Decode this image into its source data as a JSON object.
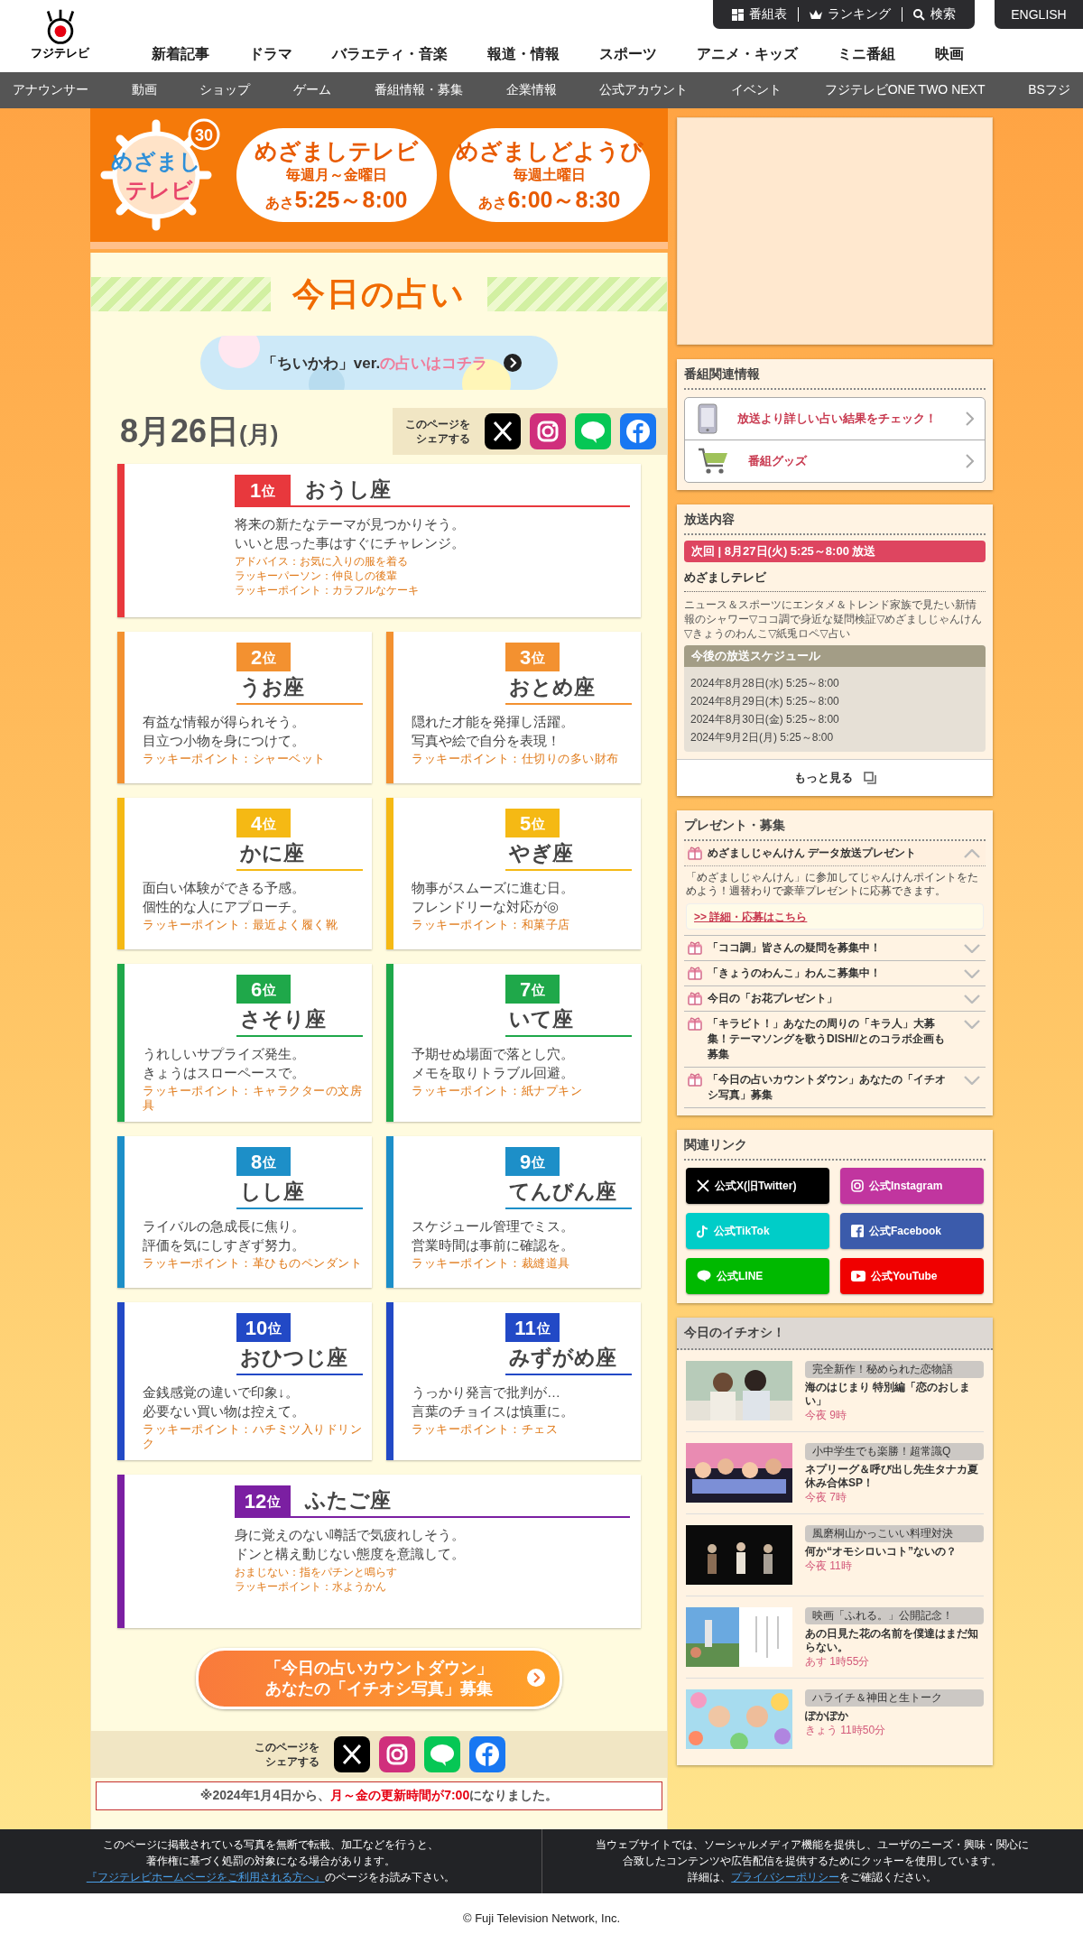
{
  "header": {
    "logo_text": "フジテレビ",
    "top_links": [
      {
        "label": "番組表",
        "kind": "grid"
      },
      {
        "label": "ランキング",
        "kind": "crown"
      },
      {
        "label": "検索",
        "kind": "search"
      }
    ],
    "english": "ENGLISH",
    "main_nav": [
      "新着記事",
      "ドラマ",
      "バラエティ・音楽",
      "報道・情報",
      "スポーツ",
      "アニメ・キッズ",
      "ミニ番組",
      "映画"
    ],
    "sub_nav": [
      "アナウンサー",
      "動画",
      "ショップ",
      "ゲーム",
      "番組情報・募集",
      "企業情報",
      "公式アカウント",
      "イベント",
      "フジテレビONE TWO NEXT",
      "BSフジ"
    ]
  },
  "banner": {
    "logo_words": [
      "めざまし",
      "テレビ"
    ],
    "logo_badge": "30",
    "shows": [
      {
        "title": "めざましテレビ",
        "days": "毎週月～金曜日",
        "time_prefix": "あさ",
        "time": "5:25～8:00"
      },
      {
        "title": "めざましどようび",
        "days": "毎週土曜日",
        "time_prefix": "あさ",
        "time": "6:00～8:30"
      }
    ]
  },
  "title": "今日の占い",
  "promo": {
    "label": "「ちいかわ」ver.",
    "label_accent": "の占いはコチラ"
  },
  "date": {
    "main": "8月26日",
    "weekday": "(月)"
  },
  "share_top": {
    "label": [
      "このページを",
      "シェアする"
    ],
    "buttons": [
      {
        "kind": "x"
      },
      {
        "kind": "instagram"
      },
      {
        "kind": "line"
      },
      {
        "kind": "facebook"
      }
    ]
  },
  "fortunes": [
    {
      "kind": "wide",
      "rank": "1",
      "unit": "位",
      "sign": "おうし座",
      "color": "#e8383d",
      "message": [
        "将来の新たなテーマが見つかりそう。",
        "いいと思った事はすぐにチャレンジ。"
      ],
      "notes": [
        "アドバイス：お気に入りの服を着る",
        "ラッキーパーソン：仲良しの後輩",
        "ラッキーポイント：カラフルなケーキ"
      ]
    },
    {
      "kind": "half",
      "rank": "2",
      "unit": "位",
      "sign": "うお座",
      "color": "#f39130",
      "message": [
        "有益な情報が得られそう。",
        "目立つ小物を身につけて。"
      ],
      "notes": [
        "ラッキーポイント：シャーベット"
      ]
    },
    {
      "kind": "half",
      "rank": "3",
      "unit": "位",
      "sign": "おとめ座",
      "color": "#f39130",
      "message": [
        "隠れた才能を発揮し活躍。",
        "写真や絵で自分を表現！"
      ],
      "notes": [
        "ラッキーポイント：仕切りの多い財布"
      ]
    },
    {
      "kind": "half",
      "rank": "4",
      "unit": "位",
      "sign": "かに座",
      "color": "#f5b914",
      "message": [
        "面白い体験ができる予感。",
        "個性的な人にアプローチ。"
      ],
      "notes": [
        "ラッキーポイント：最近よく履く靴"
      ]
    },
    {
      "kind": "half",
      "rank": "5",
      "unit": "位",
      "sign": "やぎ座",
      "color": "#f5b914",
      "message": [
        "物事がスムーズに進む日。",
        "フレンドリーな対応が◎"
      ],
      "notes": [
        "ラッキーポイント：和菓子店"
      ]
    },
    {
      "kind": "half",
      "rank": "6",
      "unit": "位",
      "sign": "さそり座",
      "color": "#1fa84a",
      "message": [
        "うれしいサプライズ発生。",
        "きょうはスローペースで。"
      ],
      "notes": [
        "ラッキーポイント：キャラクターの文房具"
      ]
    },
    {
      "kind": "half",
      "rank": "7",
      "unit": "位",
      "sign": "いて座",
      "color": "#1fa84a",
      "message": [
        "予期せぬ場面で落とし穴。",
        "メモを取りトラブル回避。"
      ],
      "notes": [
        "ラッキーポイント：紙ナプキン"
      ]
    },
    {
      "kind": "half",
      "rank": "8",
      "unit": "位",
      "sign": "しし座",
      "color": "#1d8fc8",
      "message": [
        "ライバルの急成長に焦り。",
        "評価を気にしすぎず努力。"
      ],
      "notes": [
        "ラッキーポイント：革ひものペンダント"
      ]
    },
    {
      "kind": "half",
      "rank": "9",
      "unit": "位",
      "sign": "てんびん座",
      "color": "#1d8fc8",
      "message": [
        "スケジュール管理でミス。",
        "営業時間は事前に確認を。"
      ],
      "notes": [
        "ラッキーポイント：裁縫道具"
      ]
    },
    {
      "kind": "half",
      "rank": "10",
      "unit": "位",
      "sign": "おひつじ座",
      "color": "#2249c6",
      "message": [
        "金銭感覚の違いで印象↓。",
        "必要ない買い物は控えて。"
      ],
      "notes": [
        "ラッキーポイント：ハチミツ入りドリンク"
      ]
    },
    {
      "kind": "half",
      "rank": "11",
      "unit": "位",
      "sign": "みずがめ座",
      "color": "#2249c6",
      "message": [
        "うっかり発言で批判が…",
        "言葉のチョイスは慎重に。"
      ],
      "notes": [
        "ラッキーポイント：チェス"
      ]
    },
    {
      "kind": "wide",
      "rank": "12",
      "unit": "位",
      "sign": "ふたご座",
      "color": "#7b1fa2",
      "message": [
        "身に覚えのない噂話で気疲れしそう。",
        "ドンと構え動じない態度を意識して。"
      ],
      "notes": [
        "おまじない：指をパチンと鳴らす",
        "ラッキーポイント：水ようかん"
      ]
    }
  ],
  "countdown": [
    "「今日の占いカウントダウン」",
    "あなたの「イチオシ写真」募集"
  ],
  "share_bottom": {
    "label": [
      "このページを",
      "シェアする"
    ],
    "buttons": [
      {
        "kind": "x"
      },
      {
        "kind": "instagram"
      },
      {
        "kind": "line"
      },
      {
        "kind": "facebook"
      }
    ]
  },
  "notice": {
    "before": "※2024年1月4日から、",
    "accent": "月～金の更新時間が7:00",
    "after": "になりました。"
  },
  "related": {
    "heading": "番組関連情報",
    "links": [
      {
        "kind": "phone",
        "label": "放送より詳しい占い結果をチェック！"
      },
      {
        "kind": "cart",
        "label": "番組グッズ"
      }
    ]
  },
  "broadcast": {
    "heading": "放送内容",
    "next": "次回 | 8月27日(火) 5:25～8:00 放送",
    "program": "めざましテレビ",
    "description": "ニュース＆スポーツにエンタメ＆トレンド家族で見たい新情報のシャワー▽ココ調で身近な疑問検証▽めざましじゃんけん▽きょうのわんこ▽紙兎ロペ▽占い",
    "schedule_heading": "今後の放送スケジュール",
    "schedule": [
      "2024年8月28日(水) 5:25～8:00",
      "2024年8月29日(木) 5:25～8:00",
      "2024年8月30日(金) 5:25～8:00",
      "2024年9月2日(月) 5:25～8:00"
    ],
    "more": "もっと見る"
  },
  "presents": {
    "heading": "プレゼント・募集",
    "items": [
      {
        "title": "めざましじゃんけん データ放送プレゼント",
        "expanded": true,
        "body": "「めざましじゃんけん」に参加してじゃんけんポイントをためよう！週替わりで豪華プレゼントに応募できます。",
        "link": ">> 詳細・応募はこちら"
      },
      {
        "title": "「ココ調」皆さんの疑問を募集中！",
        "expanded": false
      },
      {
        "title": "「きょうのわんこ」わんこ募集中！",
        "expanded": false
      },
      {
        "title": "今日の「お花プレゼント」",
        "expanded": false
      },
      {
        "title": "「キラビト！」あなたの周りの「キラ人」大募集！テーマソングを歌うDISH//とのコラボ企画も募集",
        "expanded": false
      },
      {
        "title": "「今日の占いカウントダウン」あなたの「イチオシ写真」募集",
        "expanded": false
      }
    ]
  },
  "links": {
    "heading": "関連リンク",
    "buttons": [
      {
        "kind": "x",
        "label": "公式X(旧Twitter)",
        "color": "#000000"
      },
      {
        "kind": "instagram",
        "label": "公式Instagram",
        "color": "#c1359f"
      },
      {
        "kind": "tiktok",
        "label": "公式TikTok",
        "color": "#00cdc8"
      },
      {
        "kind": "facebook",
        "label": "公式Facebook",
        "color": "#3b5bab"
      },
      {
        "kind": "line",
        "label": "公式LINE",
        "color": "#00b900"
      },
      {
        "kind": "youtube",
        "label": "公式YouTube",
        "color": "#f00000"
      }
    ]
  },
  "picks": {
    "heading": "今日のイチオシ！",
    "items": [
      {
        "tag": "完全新作！秘められた恋物語",
        "title": "海のはじまり 特別編「恋のおしまい」",
        "time": "今夜 9時"
      },
      {
        "tag": "小中学生でも楽勝！超常識Q",
        "title": "ネプリーグ＆呼び出し先生タナカ夏休み合体SP！",
        "time": "今夜 7時"
      },
      {
        "tag": "風磨桐山かっこいい料理対決",
        "title": "何か“オモシロいコト”ないの？",
        "time": "今夜 11時"
      },
      {
        "tag": "映画「ふれる。」公開記念！",
        "title": "あの日見た花の名前を僕達はまだ知らない。",
        "time": "あす 1時55分"
      },
      {
        "tag": "ハライチ＆神田と生トーク",
        "title": "ぽかぽか",
        "time": "きょう 11時50分"
      }
    ]
  },
  "footer": {
    "left_text": [
      "このページに掲載されている写真を無断で転載、加工などを行うと、",
      "著作権に基づく処罰の対象になる場合があります。"
    ],
    "left_link": "『フジテレビホームページをご利用される方へ』",
    "left_after": "のページをお読み下さい。",
    "right_text": [
      "当ウェブサイトでは、ソーシャルメディア機能を提供し、ユーザのニーズ・興味・関心に",
      "合致したコンテンツや広告配信を提供するためにクッキーを使用しています。"
    ],
    "right_before": "詳細は、",
    "right_link": "プライバシーポリシー",
    "right_after": "をご確認ください。",
    "copyright": "© Fuji Television Network, Inc."
  }
}
